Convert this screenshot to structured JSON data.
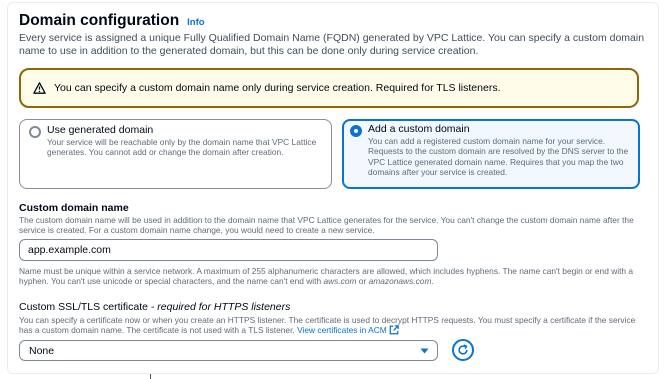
{
  "header": {
    "title": "Domain configuration",
    "info": "Info"
  },
  "description": "Every service is assigned a unique Fully Qualified Domain Name (FQDN) generated by VPC Lattice. You can specify a custom domain name to use in addition to the generated domain, but this can be done only during service creation.",
  "alert": {
    "text": "You can specify a custom domain name only during service creation. Required for TLS listeners."
  },
  "domain_options": [
    {
      "label": "Use generated domain",
      "description": "Your service will be reachable only by the domain name that VPC Lattice generates. You cannot add or change the domain after creation.",
      "selected": false
    },
    {
      "label": "Add a custom domain",
      "description": "You can add a registered custom domain name for your service. Requests to the custom domain are resolved by the DNS server to the VPC Lattice generated domain name. Requires that you map the two domains after your service is created.",
      "selected": true
    }
  ],
  "custom_domain": {
    "label": "Custom domain name",
    "description": "The custom domain name will be used in addition to the domain name that VPC Lattice generates for the service. You can't change the custom domain name after the service is created. For a custom domain name change, you would need to create a new service.",
    "value": "app.example.com",
    "constraint_pre": "Name must be unique within a service network. A maximum of 255 alphanumeric characters are allowed, which includes hyphens. The name can't begin or end with a hyphen. You can't use unicode or special characters, and the name can't end with ",
    "constraint_term1": "aws.com",
    "constraint_or": " or ",
    "constraint_term2": "amazonaws.com",
    "constraint_end": "."
  },
  "certificate": {
    "label": "Custom SSL/TLS certificate",
    "label_qualifier": " - required for HTTPS listeners",
    "description": "You can specify a certificate now or when you create an HTTPS listener. The certificate is used to decrypt HTTPS requests. You must specify a certificate if the service has a custom domain name. The certificate is not used with a TLS listener.",
    "link": "View certificates in ACM",
    "selected": "None"
  },
  "colors": {
    "accent": "#0972d3",
    "warning": "#8d6605",
    "warning_bg": "#fffce9"
  }
}
